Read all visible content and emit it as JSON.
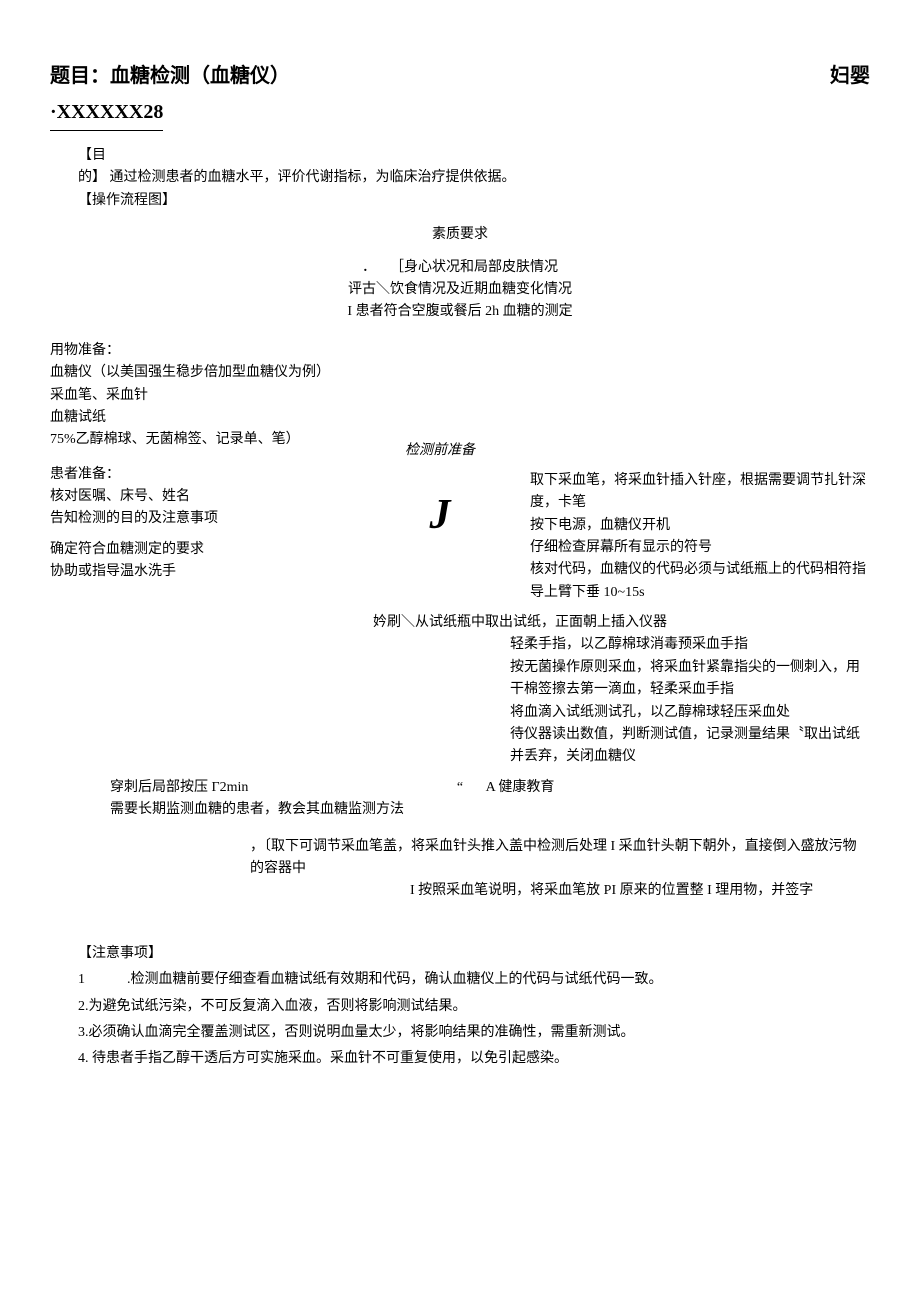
{
  "header": {
    "title_left": "题目：血糖检测（血糖仪）",
    "title_right": "妇婴",
    "code": "·XXXXXX28"
  },
  "purpose": {
    "label_open": "【目",
    "label_close": "的】",
    "text": "通过检测患者的血糖水平，评价代谢指标，为临床治疗提供依据。"
  },
  "flow_label": "【操作流程图】",
  "quality": "素质要求",
  "assess": {
    "line1": "．　　［身心状况和局部皮肤情况",
    "line2": "评古＼饮食情况及近期血糖变化情况",
    "line3": "I 患者符合空腹或餐后 2h 血糖的测定"
  },
  "prep": {
    "supply_title": "用物准备：",
    "supply1": "血糖仪（以美国强生稳步倍加型血糖仪为例）",
    "supply2": "采血笔、采血针",
    "supply3": "血糖试纸",
    "supply4": "75%乙醇棉球、无菌棉签、记录单、笔）",
    "patient_title": "患者准备：",
    "patient1": "核对医嘱、床号、姓名",
    "patient2": "告知检测的目的及注意事项",
    "patient3": "确定符合血糖测定的要求",
    "patient4": "协助或指导温水洗手",
    "mid_label": "检测前准备",
    "j_mark": "J",
    "device1": "取下采血笔，将采血针插入针座，根据需要调节扎针深度，卡笔",
    "device2": "按下电源，血糖仪开机",
    "device3": "仔细检查屏幕所有显示的符号",
    "device4": "核对代码，血糖仪的代码必须与试纸瓶上的代码相符指导上臂下垂 10~15s"
  },
  "operate": {
    "mid_line": "妗刷＼从试纸瓶中取出试纸，正面朝上插入仪器",
    "r1": "轻柔手指，以乙醇棉球消毒预采血手指",
    "r2": "按无菌操作原则采血，将采血针紧靠指尖的一侧刺入，用干棉签擦去第一滴血，轻柔采血手指",
    "r3": "将血滴入试纸测试孔，以乙醇棉球轻压采血处",
    "r4": "待仪器读出数值，判断测试值，记录测量结果〝取出试纸并丢弃，关闭血糖仪"
  },
  "edu": {
    "left1": "穿刺后局部按压 Γ2min",
    "left2": "需要长期监测血糖的患者，教会其血糖监测方法",
    "quote": "“",
    "mid": "A 健康教育"
  },
  "post": {
    "line1": "，〔取下可调节采血笔盖，将采血针头推入盖中检测后处理 I 采血针头朝下朝外，直接倒入盛放污物的容器中",
    "line2": "I 按照采血笔说明，将采血笔放 PI 原来的位置整 I 理用物，并签字"
  },
  "notes": {
    "title": "【注意事项】",
    "n1": "1　　　.检测血糖前要仔细查看血糖试纸有效期和代码，确认血糖仪上的代码与试纸代码一致。",
    "n2": "2.为避免试纸污染，不可反复滴入血液，否则将影响测试结果。",
    "n3": "3.必须确认血滴完全覆盖测试区，否则说明血量太少，将影响结果的准确性，需重新测试。",
    "n4": "4. 待患者手指乙醇干透后方可实施采血。采血针不可重复使用，以免引起感染。"
  }
}
